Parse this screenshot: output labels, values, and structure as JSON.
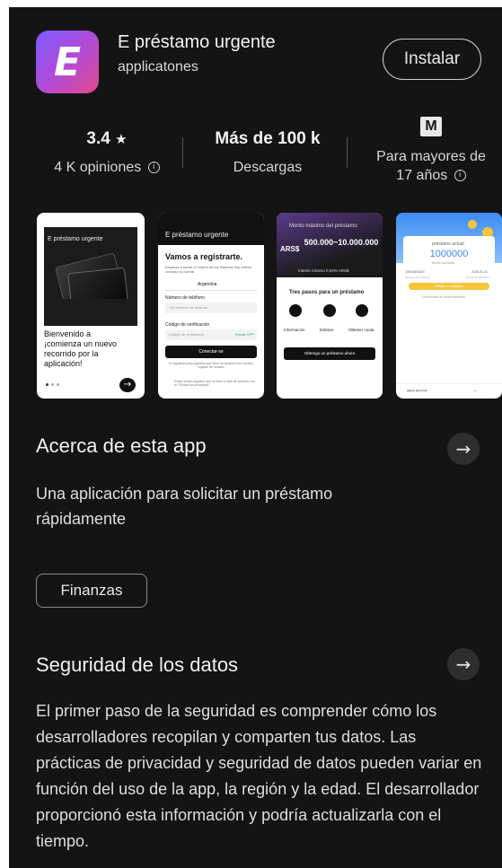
{
  "app": {
    "icon_letter": "E",
    "title": "E préstamo urgente",
    "developer": "applicatones",
    "install_label": "Instalar"
  },
  "stats": {
    "rating": "3.4",
    "rating_star": "★",
    "reviews": "4 K opiniones",
    "downloads": "Más de 100 k",
    "downloads_label": "Descargas",
    "age_badge": "M",
    "age_line1": "Para mayores de",
    "age_line2": "17 años",
    "info_glyph": "i"
  },
  "screenshots": {
    "s1": {
      "title": "E préstamo urgente",
      "text1": "Bienvenido a",
      "text2": "¡comienza un nuevo",
      "text3": "recorrido por la",
      "text4": "aplicación!",
      "arrow": "→"
    },
    "s2": {
      "header": "E préstamo urgente",
      "heading": "Vamos a registrarte.",
      "sub": "Empieza a tomar el control de tus finanzas hoy mismo creando tu cuenta",
      "country": "Argentina",
      "phone_label": "Número de teléfono",
      "phone_placeholder": "+54  Número de teléfono",
      "code_label": "Código de verificación",
      "code_placeholder": "Código de verificación",
      "send_code": "Enviar OTP",
      "connect": "Conectar-se",
      "terms": "El siguiente paso significa que tiene de acuerdo con nuestro registro de usuario",
      "privacy": "Iniciar sesión significa que ha leído y está de acuerdo con la \"Política de privacidad\""
    },
    "s3": {
      "header": "Monto máximo del préstamo",
      "currency": "ARS$",
      "amount": "500.000~10.000.000",
      "rate": "Interés mínimo 0,04% ARS$",
      "steps_title": "Tres pasos para un préstamo",
      "step1": "Información",
      "step2": "Estimar",
      "step3": "Obtener cuota",
      "cta": "Obtenga un préstamo ahora"
    },
    "s4": {
      "label": "préstamo actual",
      "amount": "1000000",
      "sub": "Monto aprobado",
      "left_num": "15016843200",
      "right_date": "2026-01-31",
      "left_cap": "Número de préstamo",
      "right_cap": "Fecha de aplicación",
      "button": "Solicitar un préstamo",
      "link": "Condiciones de endeudamiento",
      "nav1": "página del portal",
      "nav2": "mí"
    }
  },
  "about": {
    "title": "Acerca de esta app",
    "line1": "Una aplicación para solicitar un préstamo",
    "line2": "rápidamente",
    "chip": "Finanzas",
    "arrow": "→"
  },
  "safety": {
    "title": "Seguridad de los datos",
    "arrow": "→",
    "text": "El primer paso de la seguridad es comprender cómo los desarrolladores recopilan y comparten tus datos. Las prácticas de privacidad y seguridad de datos pueden variar en función del uso de la app, la región y la edad. El desarrollador proporcionó esta información y podría actualizarla con el tiempo."
  },
  "colors": {
    "background": "#141414",
    "icon_gradient_start": "#7a5cff",
    "icon_gradient_end": "#e24a8a",
    "accent_yellow": "#f5c53a",
    "accent_blue": "#3c8cf0"
  }
}
